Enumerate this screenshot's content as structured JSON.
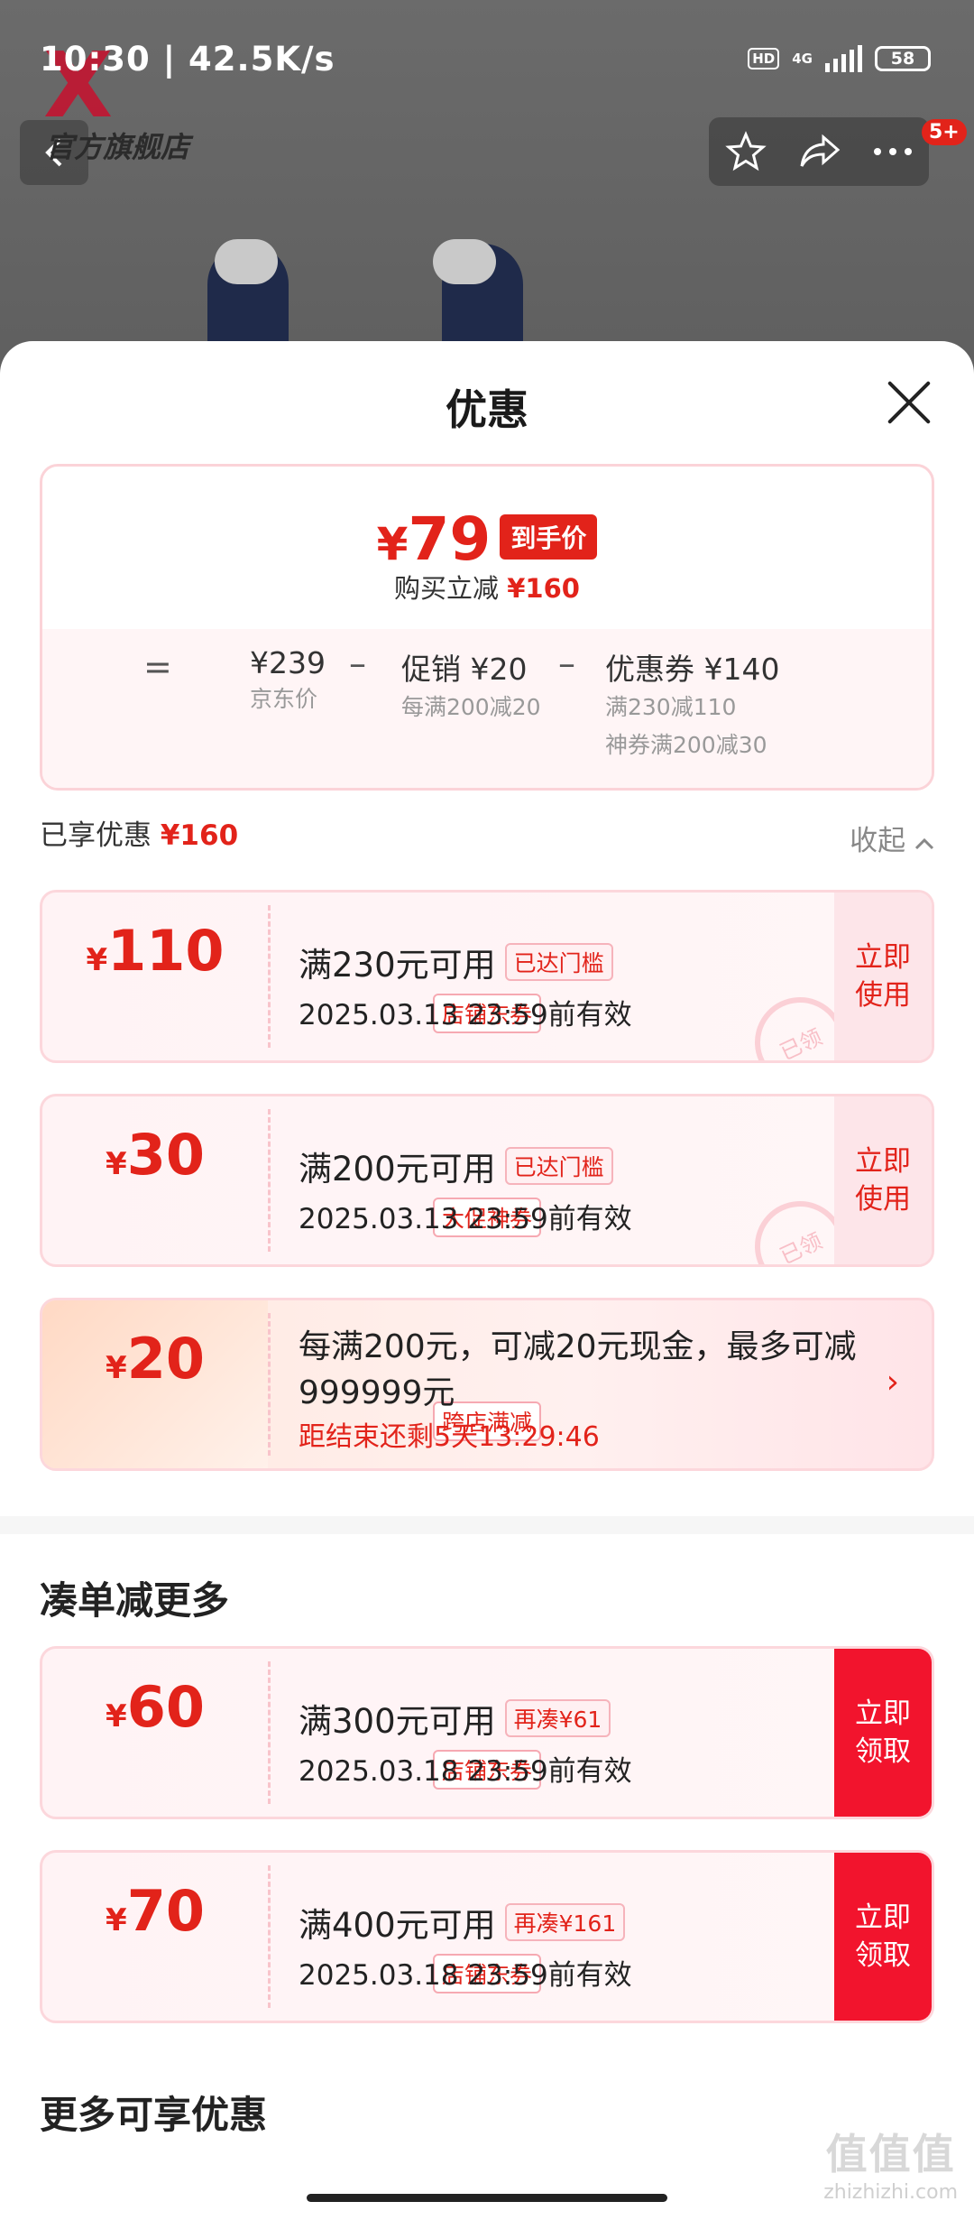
{
  "status_bar": {
    "time_speed": "10:30 | 42.5K/s",
    "hd": "HD",
    "network": "4G",
    "battery": "58"
  },
  "header": {
    "shop_name": "官方旗舰店",
    "back_icon": "chevron-left-icon",
    "cart_badge": "5+"
  },
  "sheet": {
    "title": "优惠",
    "summary": {
      "currency": "¥",
      "final_price": "79",
      "final_tag": "到手价",
      "buy_prefix": "购买立减",
      "buy_amount": "¥160",
      "eq": "=",
      "jd_price": "¥239",
      "jd_label": "京东价",
      "minus1": "–",
      "promo_main": "促销 ¥20",
      "promo_sub": "每满200减20",
      "minus2": "–",
      "coupon_main": "优惠券 ¥140",
      "coupon_sub1": "满230减110",
      "coupon_sub2": "神券满200减30"
    },
    "enjoyed_label": "已享优惠",
    "enjoyed_amount": "¥160",
    "collapse_label": "收起",
    "coupons": [
      {
        "yen": "¥",
        "amount": "110",
        "type": "店铺东券",
        "cond": "满230元可用",
        "chip": "已达门槛",
        "date": "2025.03.13 23:59前有效",
        "action": "立即使用",
        "stamp": "已领"
      },
      {
        "yen": "¥",
        "amount": "30",
        "type": "大促神券",
        "cond": "满200元可用",
        "chip": "已达门槛",
        "date": "2025.03.13 23:59前有效",
        "action": "立即使用",
        "stamp": "已领"
      }
    ],
    "promo": {
      "yen": "¥",
      "amount": "20",
      "type": "跨店满减",
      "desc": "每满200元，可减20元现金，最多可减999999元",
      "countdown": "距结束还剩5天13:29:46",
      "arrow": "›"
    },
    "section_more": "凑单减更多",
    "more_coupons": [
      {
        "yen": "¥",
        "amount": "60",
        "type": "店铺东券",
        "cond": "满300元可用",
        "chip": "再凑¥61",
        "date": "2025.03.18 23:59前有效",
        "action": "立即领取"
      },
      {
        "yen": "¥",
        "amount": "70",
        "type": "店铺东券",
        "cond": "满400元可用",
        "chip": "再凑¥161",
        "date": "2025.03.18 23:59前有效",
        "action": "立即领取"
      }
    ],
    "section_extra": "更多可享优惠"
  },
  "watermark": {
    "big": "值值值",
    "small": "zhizhizhi.com"
  },
  "colors": {
    "accent": "#e2231a",
    "coupon_bg": "#fff3f5",
    "button_red": "#f2142d"
  }
}
